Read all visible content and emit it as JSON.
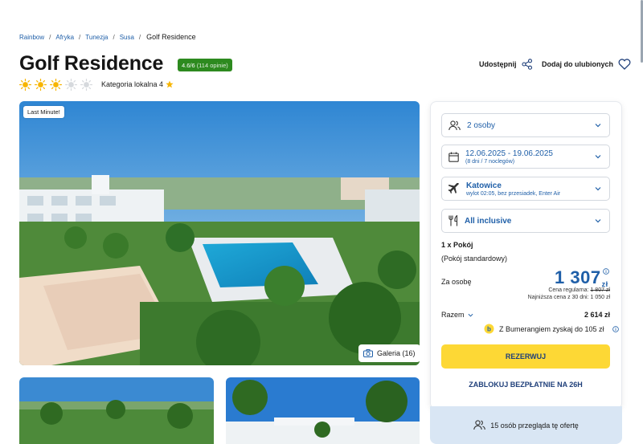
{
  "breadcrumb": [
    "Rainbow",
    "Afryka",
    "Tunezja",
    "Susa",
    "Golf Residence"
  ],
  "breadcrumb_sep": "/",
  "hotel": {
    "title": "Golf Residence",
    "rating_score": "4.6/6",
    "rating_count": "(114 opinie)",
    "category_label": "Kategoria lokalna 4",
    "sun_rating": 3,
    "sun_max": 5
  },
  "actions": {
    "share": "Udostępnij",
    "favorite": "Dodaj do ulubionych"
  },
  "hero": {
    "badge": "Last Minute!",
    "gallery": "Galeria (16)"
  },
  "booking": {
    "persons": "2 osoby",
    "dates": "12.06.2025 - 19.06.2025",
    "dates_sub": "(8 dni / 7 noclegów)",
    "departure": "Katowice",
    "departure_sub": "wylot 02:05, bez przesiadek, Enter Air",
    "board": "All inclusive",
    "room_count": "1 x Pokój",
    "room_type": "(Pokój standardowy)",
    "per_person_label": "Za osobę",
    "price": "1 307",
    "currency": "zł",
    "regular_label": "Cena regularna:",
    "regular_price": "1 807 zł",
    "lowest_label": "Najniższa cena z 30 dni: 1 050 zł",
    "total_label": "Razem",
    "total_value": "2 614 zł",
    "bumerang": "Z Bumerangiem zyskaj do 105 zł",
    "reserve": "REZERWUJ",
    "block": "ZABLOKUJ BEZPŁATNIE NA 26H",
    "viewers": "15 osób przegląda tę ofertę"
  },
  "colors": {
    "accent": "#1f5fa8",
    "rating": "#2d8a1f",
    "cta": "#fdd835",
    "sun": "#f7b500"
  }
}
